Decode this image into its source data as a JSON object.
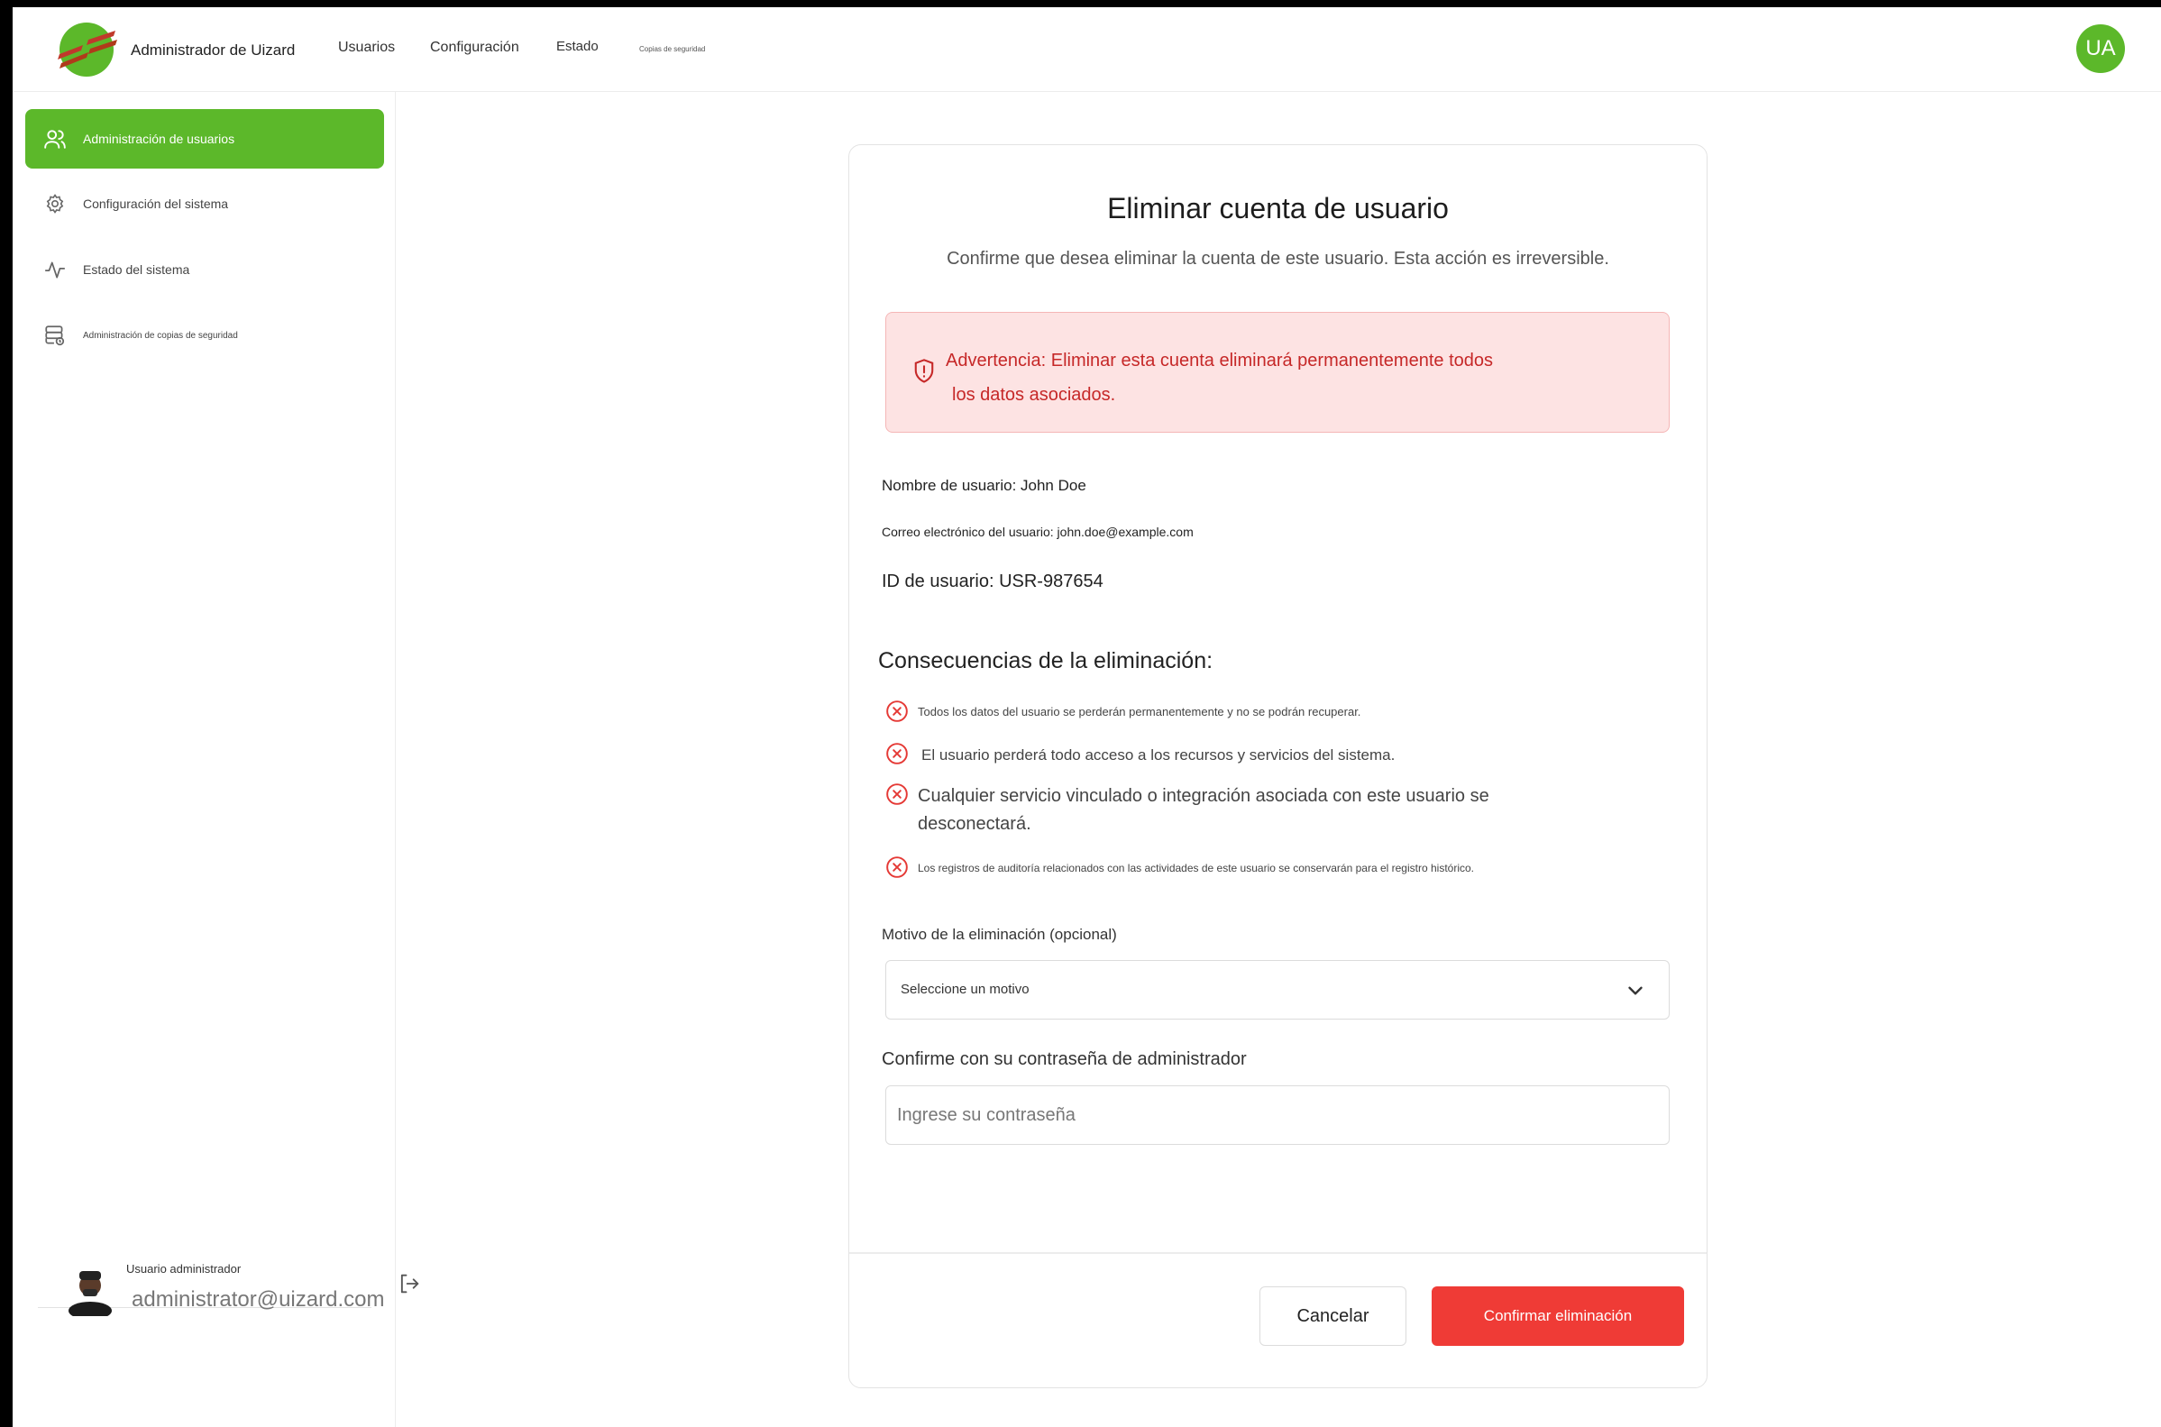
{
  "header": {
    "app_title": "Administrador de Uizard",
    "nav": [
      "Usuarios",
      "Configuración",
      "Estado",
      "Copias de seguridad"
    ],
    "avatar_initials": "UA"
  },
  "sidebar": {
    "items": [
      {
        "label": "Administración de usuarios",
        "icon": "users-icon",
        "active": true
      },
      {
        "label": "Configuración del sistema",
        "icon": "gear-icon",
        "active": false
      },
      {
        "label": "Estado del sistema",
        "icon": "activity-icon",
        "active": false
      },
      {
        "label": "Administración de copias de seguridad",
        "icon": "database-backup-icon",
        "active": false
      }
    ],
    "user": {
      "role": "Usuario administrador",
      "email": "administrator@uizard.com"
    }
  },
  "dialog": {
    "title": "Eliminar cuenta de usuario",
    "subtitle": "Confirme que desea eliminar la cuenta de este usuario. Esta acción es irreversible.",
    "warning_line1": "Advertencia: Eliminar esta cuenta eliminará permanentemente todos",
    "warning_line2": "los datos asociados.",
    "username": "Nombre de usuario: John Doe",
    "email": "Correo electrónico del usuario: john.doe@example.com",
    "user_id": "ID de usuario: USR-987654",
    "consequences_title": "Consecuencias de la eliminación:",
    "consequences": [
      "Todos los datos del usuario se perderán permanentemente y no se podrán recuperar.",
      "El usuario perderá todo acceso a los recursos y servicios del sistema.",
      "Cualquier servicio vinculado o integración asociada con este usuario se desconectará.",
      "Los registros de auditoría relacionados con las actividades de este usuario se conservarán para el registro histórico."
    ],
    "reason_label": "Motivo de la eliminación (opcional)",
    "reason_value": "Seleccione un motivo",
    "password_label": "Confirme con su contraseña de administrador",
    "password_placeholder": "Ingrese su contraseña",
    "cancel_label": "Cancelar",
    "confirm_label": "Confirmar eliminación"
  },
  "colors": {
    "accent": "#5cb82a",
    "danger": "#ef3b36",
    "warning_bg": "#fde3e3",
    "warning_text": "#c62828"
  }
}
